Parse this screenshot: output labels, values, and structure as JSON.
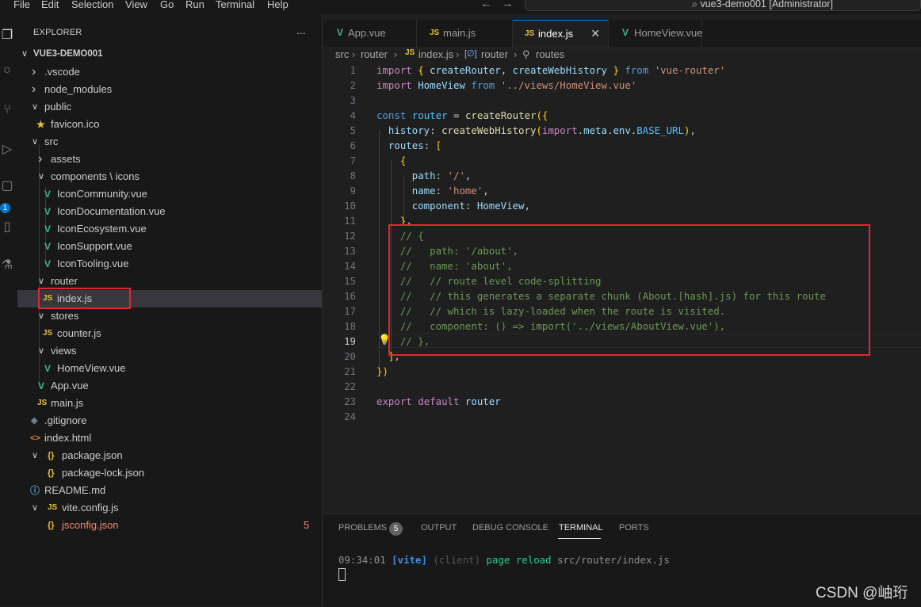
{
  "menu": [
    "File",
    "Edit",
    "Selection",
    "View",
    "Go",
    "Run",
    "Terminal",
    "Help"
  ],
  "command_center": "vue3-demo001 [Administrator]",
  "explorer": {
    "title": "EXPLORER",
    "more": "...",
    "project": "VUE3-DEMO001",
    "items": [
      {
        "label": ".vscode",
        "icon": "chevron-right"
      },
      {
        "label": "node_modules",
        "icon": "chevron-right"
      },
      {
        "label": "public",
        "icon": "chevron-down"
      },
      {
        "label": "favicon.ico",
        "icon": "star-icon"
      },
      {
        "label": "src",
        "icon": "chevron-down"
      },
      {
        "label": "assets",
        "icon": "chevron-right"
      },
      {
        "label": "components \\ icons",
        "icon": "chevron-down"
      },
      {
        "label": "IconCommunity.vue",
        "icon": "vue-icon"
      },
      {
        "label": "IconDocumentation.vue",
        "icon": "vue-icon"
      },
      {
        "label": "IconEcosystem.vue",
        "icon": "vue-icon"
      },
      {
        "label": "IconSupport.vue",
        "icon": "vue-icon"
      },
      {
        "label": "IconTooling.vue",
        "icon": "vue-icon"
      },
      {
        "label": "router",
        "icon": "chevron-down"
      },
      {
        "label": "index.js",
        "icon": "js-icon"
      },
      {
        "label": "stores",
        "icon": "chevron-down"
      },
      {
        "label": "counter.js",
        "icon": "js-icon"
      },
      {
        "label": "views",
        "icon": "chevron-down"
      },
      {
        "label": "HomeView.vue",
        "icon": "vue-icon"
      },
      {
        "label": "App.vue",
        "icon": "vue-icon"
      },
      {
        "label": "main.js",
        "icon": "js-icon"
      },
      {
        "label": ".gitignore",
        "icon": "git-icon"
      },
      {
        "label": "index.html",
        "icon": "html-icon"
      },
      {
        "label": "package.json",
        "icon": "json-icon"
      },
      {
        "label": "package-lock.json",
        "icon": "json-icon"
      },
      {
        "label": "README.md",
        "icon": "info-icon"
      },
      {
        "label": "vite.config.js",
        "icon": "js-icon"
      },
      {
        "label": "jsconfig.json",
        "icon": "json-icon",
        "badge": "5"
      }
    ]
  },
  "tabs": [
    {
      "label": "App.vue",
      "icon": "vue-icon"
    },
    {
      "label": "main.js",
      "icon": "js-icon"
    },
    {
      "label": "index.js",
      "icon": "js-icon",
      "active": true
    },
    {
      "label": "HomeView.vue",
      "icon": "vue-icon"
    }
  ],
  "breadcrumb": [
    "src",
    "router",
    "index.js",
    "router",
    "routes"
  ],
  "icon_labels": {
    "js": "JS",
    "vue": "V",
    "json": "{}"
  },
  "code_lines": [
    "import { createRouter, createWebHistory } from 'vue-router'",
    "import HomeView from '../views/HomeView.vue'",
    "",
    "const router = createRouter({",
    "  history: createWebHistory(import.meta.env.BASE_URL),",
    "  routes: [",
    "    {",
    "      path: '/',",
    "      name: 'home',",
    "      component: HomeView,",
    "    },",
    "    // {",
    "    //   path: '/about',",
    "    //   name: 'about',",
    "    //   // route level code-splitting",
    "    //   // this generates a separate chunk (About.[hash].js) for this route",
    "    //   // which is lazy-loaded when the route is visited.",
    "    //   component: () => import('../views/AboutView.vue'),",
    "    // },",
    "  ],",
    "})",
    "",
    "export default router",
    ""
  ],
  "current_line": 19,
  "panel": {
    "tabs": [
      "PROBLEMS",
      "OUTPUT",
      "DEBUG CONSOLE",
      "TERMINAL",
      "PORTS"
    ],
    "active": "TERMINAL",
    "problems_count": "5",
    "terminal": {
      "time": "09:34:01",
      "tag": "[vite]",
      "client": "(client)",
      "message": "page reload",
      "path": "src/router/index.js"
    }
  },
  "watermark": "CSDN @岫珩"
}
